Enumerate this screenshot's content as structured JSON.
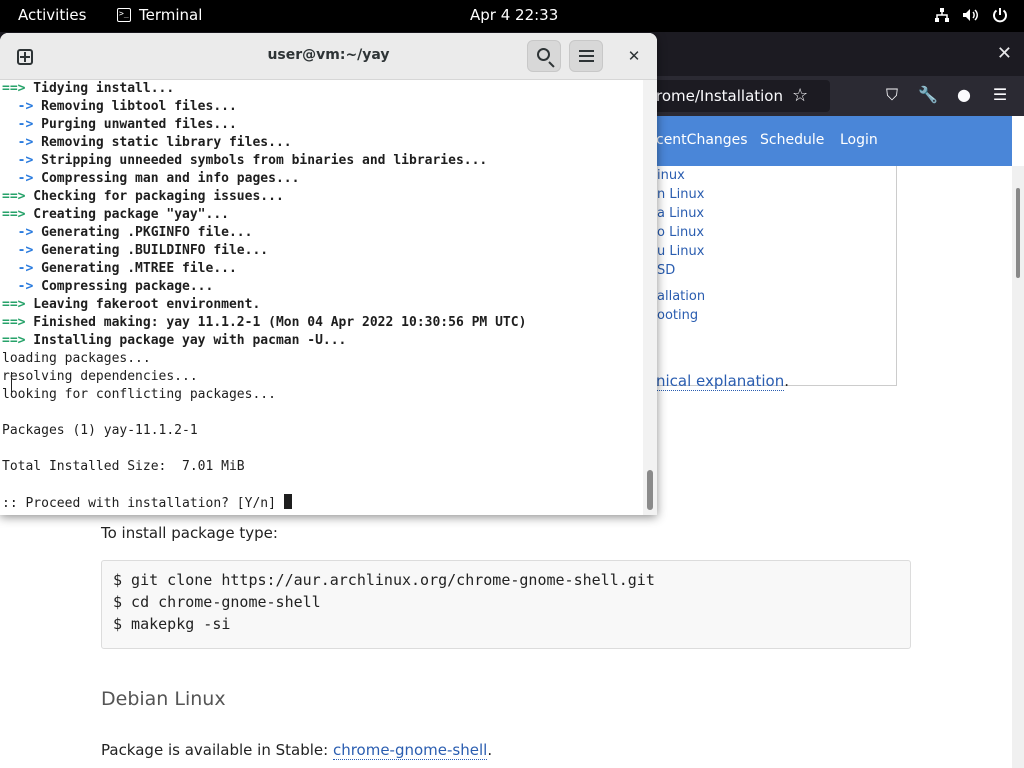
{
  "topbar": {
    "activities": "Activities",
    "app_name": "Terminal",
    "clock": "Apr 4  22:33"
  },
  "browser": {
    "url_fragment": "rome/Installation",
    "nav_links": [
      "centChanges",
      "Schedule",
      "Login"
    ],
    "toc_items": [
      "inux",
      "n Linux",
      "a Linux",
      "o Linux",
      "u Linux",
      "SD",
      "allation",
      "ooting"
    ],
    "text_fragment": "nical explanation",
    "install_prompt": "To install package type:",
    "code_lines": [
      "$ git clone https://aur.archlinux.org/chrome-gnome-shell.git",
      "$ cd chrome-gnome-shell",
      "$ makepkg -si"
    ],
    "section_heading": "Debian Linux",
    "stable_text": "Package is available in Stable: ",
    "stable_link": "chrome-gnome-shell"
  },
  "terminal": {
    "title": "user@vm:~/yay",
    "lines": [
      {
        "prefix": "==>",
        "text": " Tidying install...",
        "kind": "green"
      },
      {
        "prefix": "  ->",
        "text": " Removing libtool files...",
        "kind": "blue"
      },
      {
        "prefix": "  ->",
        "text": " Purging unwanted files...",
        "kind": "blue"
      },
      {
        "prefix": "  ->",
        "text": " Removing static library files...",
        "kind": "blue"
      },
      {
        "prefix": "  ->",
        "text": " Stripping unneeded symbols from binaries and libraries...",
        "kind": "blue"
      },
      {
        "prefix": "  ->",
        "text": " Compressing man and info pages...",
        "kind": "blue"
      },
      {
        "prefix": "==>",
        "text": " Checking for packaging issues...",
        "kind": "green"
      },
      {
        "prefix": "==>",
        "text": " Creating package \"yay\"...",
        "kind": "green"
      },
      {
        "prefix": "  ->",
        "text": " Generating .PKGINFO file...",
        "kind": "blue"
      },
      {
        "prefix": "  ->",
        "text": " Generating .BUILDINFO file...",
        "kind": "blue"
      },
      {
        "prefix": "  ->",
        "text": " Generating .MTREE file...",
        "kind": "blue"
      },
      {
        "prefix": "  ->",
        "text": " Compressing package...",
        "kind": "blue"
      },
      {
        "prefix": "==>",
        "text": " Leaving fakeroot environment.",
        "kind": "green"
      },
      {
        "prefix": "==>",
        "text": " Finished making: yay 11.1.2-1 (Mon 04 Apr 2022 10:30:56 PM UTC)",
        "kind": "green"
      },
      {
        "prefix": "==>",
        "text": " Installing package yay with pacman -U...",
        "kind": "green"
      },
      {
        "prefix": "",
        "text": "loading packages...",
        "kind": "plain"
      },
      {
        "prefix": "",
        "text": "resolving dependencies...",
        "kind": "plain"
      },
      {
        "prefix": "",
        "text": "looking for conflicting packages...",
        "kind": "plain"
      },
      {
        "prefix": "",
        "text": "",
        "kind": "plain"
      },
      {
        "prefix": "",
        "text": "Packages (1) yay-11.1.2-1",
        "kind": "plain"
      },
      {
        "prefix": "",
        "text": "",
        "kind": "plain"
      },
      {
        "prefix": "",
        "text": "Total Installed Size:  7.01 MiB",
        "kind": "plain"
      },
      {
        "prefix": "",
        "text": "",
        "kind": "plain"
      },
      {
        "prefix": "",
        "text": ":: Proceed with installation? [Y/n] ",
        "kind": "prompt"
      }
    ]
  }
}
